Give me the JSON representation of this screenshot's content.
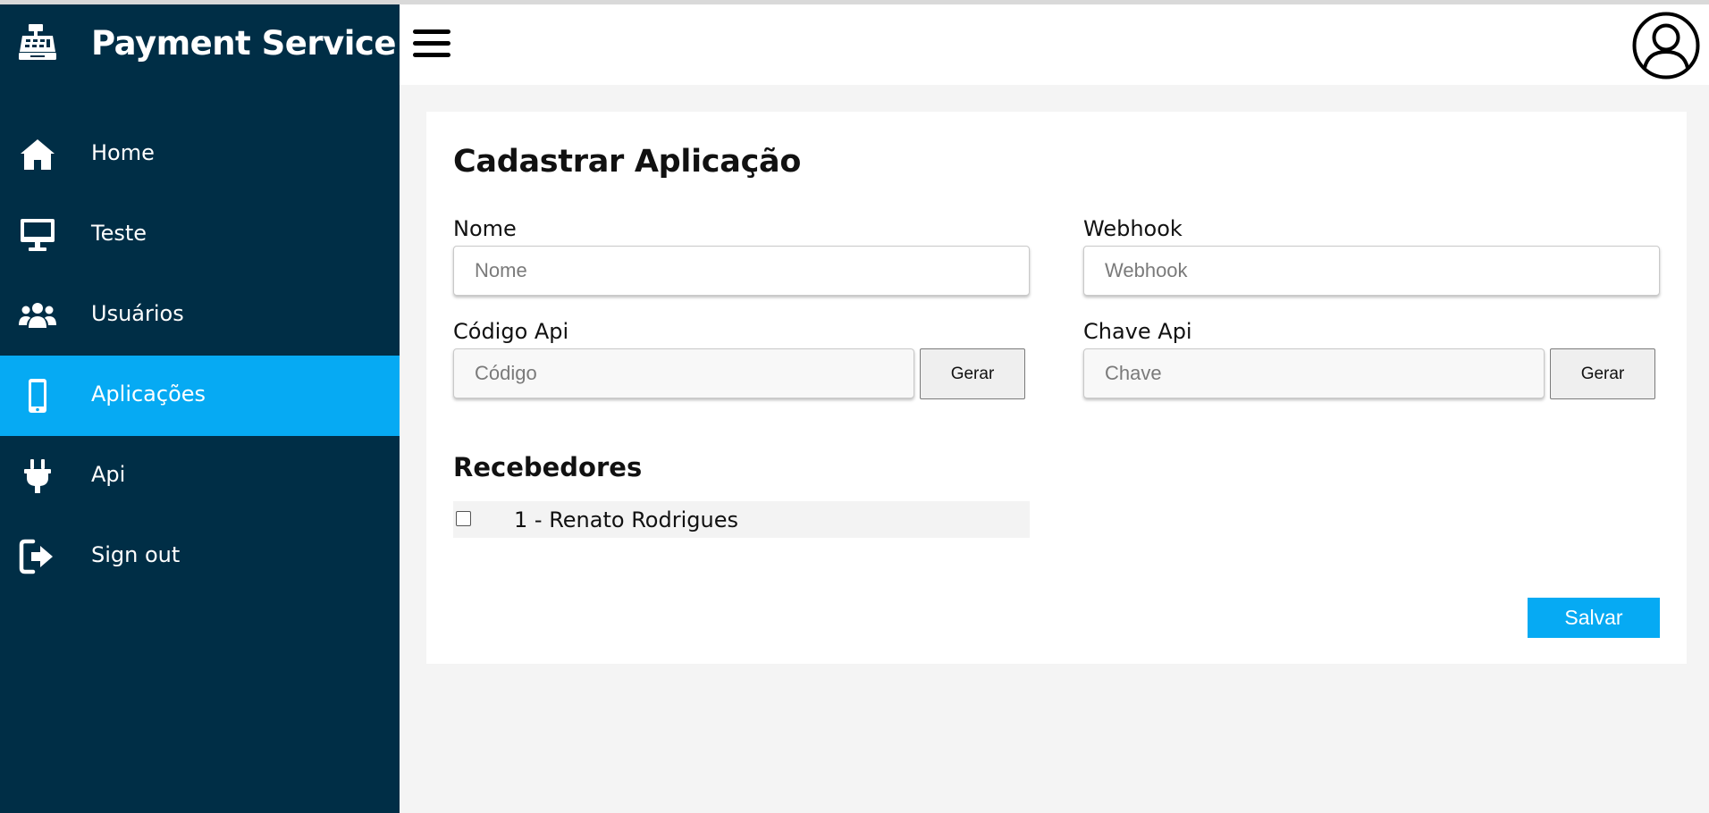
{
  "app": {
    "title": "Payment Service"
  },
  "sidebar": {
    "items": [
      {
        "label": "Home",
        "icon": "home-icon"
      },
      {
        "label": "Teste",
        "icon": "monitor-icon"
      },
      {
        "label": "Usuários",
        "icon": "users-icon"
      },
      {
        "label": "Aplicações",
        "icon": "mobile-icon",
        "active": true
      },
      {
        "label": "Api",
        "icon": "plug-icon"
      },
      {
        "label": "Sign out",
        "icon": "sign-out-icon"
      }
    ]
  },
  "header": {
    "menu_icon": "hamburger-icon",
    "avatar_icon": "user-circle-icon"
  },
  "form": {
    "title": "Cadastrar Aplicação",
    "nome": {
      "label": "Nome",
      "placeholder": "Nome",
      "value": ""
    },
    "webhook": {
      "label": "Webhook",
      "placeholder": "Webhook",
      "value": ""
    },
    "codigo": {
      "label": "Código Api",
      "placeholder": "Código",
      "value": "",
      "button": "Gerar"
    },
    "chave": {
      "label": "Chave Api",
      "placeholder": "Chave",
      "value": "",
      "button": "Gerar"
    },
    "recebedores": {
      "title": "Recebedores",
      "items": [
        {
          "label": "1 - Renato Rodrigues",
          "checked": false
        }
      ]
    },
    "save_label": "Salvar"
  },
  "colors": {
    "sidebar_bg": "#002e46",
    "accent": "#06aaf3",
    "page_bg": "#f4f4f4"
  }
}
